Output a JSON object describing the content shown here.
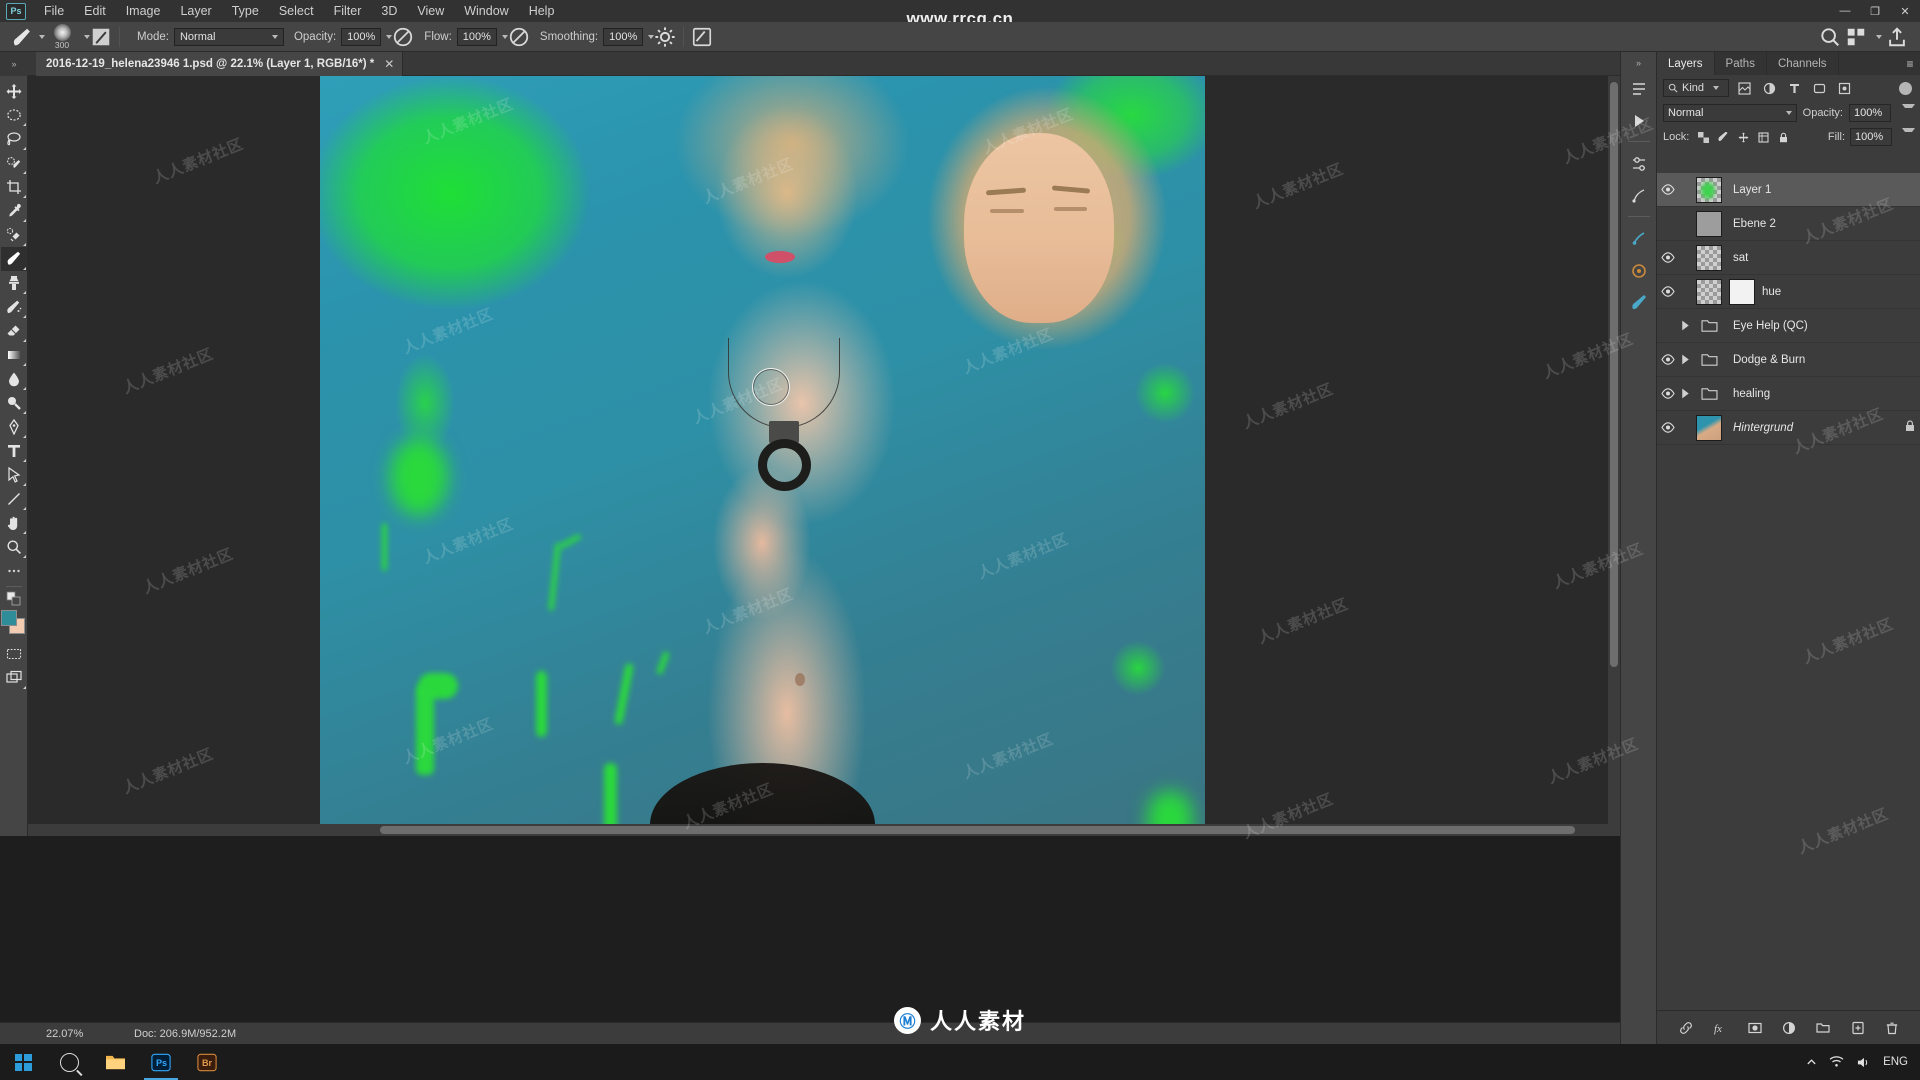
{
  "app": {
    "name": "Adobe Photoshop",
    "logo_text": "Ps"
  },
  "menubar": {
    "items": [
      "File",
      "Edit",
      "Image",
      "Layer",
      "Type",
      "Select",
      "Filter",
      "3D",
      "View",
      "Window",
      "Help"
    ],
    "watermark_url": "www.rrcg.cn",
    "window_controls": {
      "minimize": "—",
      "maximize": "❐",
      "close": "✕"
    }
  },
  "options_bar": {
    "brush_size": "300",
    "mode_label": "Mode:",
    "mode_value": "Normal",
    "opacity_label": "Opacity:",
    "opacity_value": "100%",
    "flow_label": "Flow:",
    "flow_value": "100%",
    "smoothing_label": "Smoothing:",
    "smoothing_value": "100%"
  },
  "document": {
    "tab_title": "2016-12-19_helena23946 1.psd @ 22.1% (Layer 1, RGB/16*) *",
    "close_glyph": "✕"
  },
  "toolbar": {
    "tools": [
      {
        "name": "move-tool",
        "icon": "move"
      },
      {
        "name": "marquee-tool",
        "icon": "marquee"
      },
      {
        "name": "lasso-tool",
        "icon": "lasso"
      },
      {
        "name": "quick-selection-tool",
        "icon": "quick-select"
      },
      {
        "name": "crop-tool",
        "icon": "crop"
      },
      {
        "name": "eyedropper-tool",
        "icon": "eyedropper"
      },
      {
        "name": "healing-brush-tool",
        "icon": "healing"
      },
      {
        "name": "brush-tool",
        "icon": "brush"
      },
      {
        "name": "clone-stamp-tool",
        "icon": "stamp"
      },
      {
        "name": "history-brush-tool",
        "icon": "history-brush"
      },
      {
        "name": "eraser-tool",
        "icon": "eraser"
      },
      {
        "name": "gradient-tool",
        "icon": "gradient"
      },
      {
        "name": "blur-tool",
        "icon": "blur"
      },
      {
        "name": "dodge-tool",
        "icon": "dodge"
      },
      {
        "name": "pen-tool",
        "icon": "pen"
      },
      {
        "name": "type-tool",
        "icon": "type"
      },
      {
        "name": "path-selection-tool",
        "icon": "path-select"
      },
      {
        "name": "line-tool",
        "icon": "line"
      },
      {
        "name": "hand-tool",
        "icon": "hand"
      },
      {
        "name": "zoom-tool",
        "icon": "zoom"
      },
      {
        "name": "more-tools",
        "icon": "ellipsis"
      }
    ],
    "active_tool": "brush-tool",
    "foreground_color": "#2e8d99",
    "background_color": "#f2cbb1"
  },
  "status_bar": {
    "zoom": "22.07%",
    "doc_info": "Doc: 206.9M/952.2M"
  },
  "right_dock": {
    "collapse_glyph": "»",
    "rail_icons": [
      "history-panel-icon",
      "actions-panel-icon",
      "adjustments-panel-icon",
      "styles-panel-icon",
      "properties-panel-icon",
      "brush-settings-panel-icon",
      "color-panel-icon",
      "brushes-panel-icon"
    ]
  },
  "layers_panel": {
    "tabs": [
      {
        "label": "Layers",
        "active": true
      },
      {
        "label": "Paths",
        "active": false
      },
      {
        "label": "Channels",
        "active": false
      }
    ],
    "menu_glyph": "≡",
    "filter": {
      "kind_label": "Kind",
      "icons": [
        "filter-pixel-icon",
        "filter-adjustment-icon",
        "filter-type-icon",
        "filter-shape-icon",
        "filter-smart-icon"
      ]
    },
    "blend_mode": "Normal",
    "opacity_label": "Opacity:",
    "opacity_value": "100%",
    "lock_label": "Lock:",
    "fill_label": "Fill:",
    "fill_value": "100%",
    "lock_buttons": [
      "lock-transparent-icon",
      "lock-image-icon",
      "lock-position-icon",
      "lock-artboard-icon",
      "lock-all-icon"
    ],
    "layers": [
      {
        "name": "Layer 1",
        "visible": true,
        "selected": true,
        "thumb": "checker-green",
        "kind": "pixel",
        "expandable": false,
        "locked": false
      },
      {
        "name": "Ebene 2",
        "visible": false,
        "selected": false,
        "thumb": "gray",
        "kind": "pixel",
        "expandable": false,
        "locked": false
      },
      {
        "name": "sat",
        "visible": true,
        "selected": false,
        "thumb": "checker",
        "kind": "pixel",
        "expandable": false,
        "locked": false
      },
      {
        "name": "hue",
        "visible": true,
        "selected": false,
        "thumb": "checker",
        "kind": "adjustment",
        "expandable": false,
        "locked": false
      },
      {
        "name": "Eye Help (QC)",
        "visible": false,
        "selected": false,
        "thumb": "folder",
        "kind": "group",
        "expandable": true,
        "locked": false
      },
      {
        "name": "Dodge & Burn",
        "visible": true,
        "selected": false,
        "thumb": "folder",
        "kind": "group",
        "expandable": true,
        "locked": false
      },
      {
        "name": "healing",
        "visible": true,
        "selected": false,
        "thumb": "folder",
        "kind": "group",
        "expandable": true,
        "locked": false
      },
      {
        "name": "Hintergrund",
        "visible": true,
        "selected": false,
        "thumb": "photo",
        "kind": "background",
        "expandable": false,
        "locked": true
      }
    ],
    "footer_buttons": [
      "link-layers-icon",
      "layer-style-icon",
      "layer-mask-icon",
      "adjustment-layer-icon",
      "new-group-icon",
      "new-layer-icon",
      "delete-layer-icon"
    ]
  },
  "canvas": {
    "brush_cursor_visible": true
  },
  "watermarks": {
    "tile_text": "人人素材社区",
    "bottom_text": "人人素材",
    "bottom_logo": "Ⓜ"
  },
  "taskbar": {
    "start_label": "start-button",
    "pinned": [
      "file-explorer-icon",
      "photoshop-icon",
      "bridge-icon"
    ],
    "language": "ENG",
    "tray": [
      "show-hidden-icons",
      "network-icon",
      "volume-icon"
    ]
  },
  "colors": {
    "menubar_bg": "#323232",
    "panel_bg": "#3c3c3c",
    "options_bg": "#454545",
    "canvas_bg": "#2a2a2a",
    "selected_row": "#5a5a5a",
    "accent_green": "#2ad93c",
    "accent_teal": "#2e94ad"
  }
}
